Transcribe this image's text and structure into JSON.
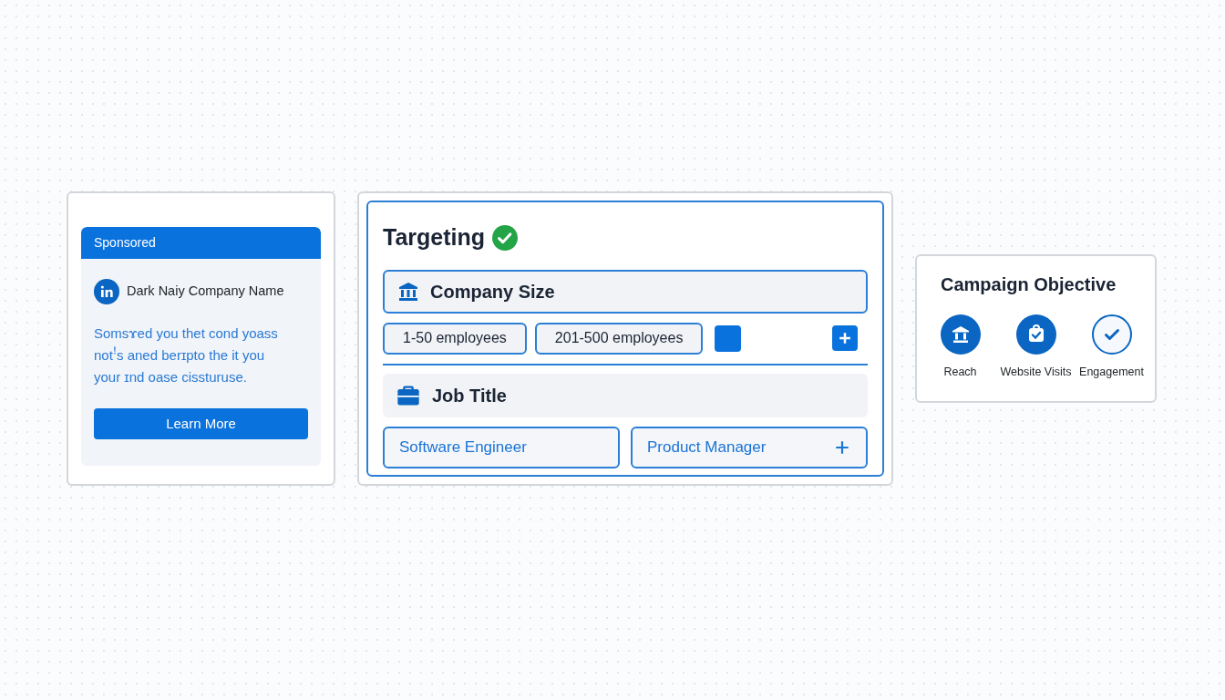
{
  "ad_preview": {
    "header": "Sponsored",
    "company": "Dark Naiy Company Name",
    "body": "Somsɤed you thet cond yoass notꜝs aned berɪpto the it you your ɪnd oase cissturuse.",
    "button": "Learn More"
  },
  "targeting": {
    "title": "Targeting",
    "complete": true,
    "sections": [
      {
        "kind": "company",
        "label": "Company Size",
        "chips": [
          "1-50 employees",
          "201-500 employees"
        ]
      },
      {
        "kind": "job",
        "label": "Job Title",
        "chips": [
          "Software Engineer",
          "Product Manager"
        ]
      }
    ]
  },
  "objective": {
    "title": "Campaign Objective",
    "options": [
      {
        "label": "Reach",
        "kind": "bank",
        "filled": true
      },
      {
        "label": "Website Visits",
        "kind": "badge",
        "filled": true
      },
      {
        "label": "Engagement",
        "kind": "check",
        "filled": false
      }
    ]
  }
}
